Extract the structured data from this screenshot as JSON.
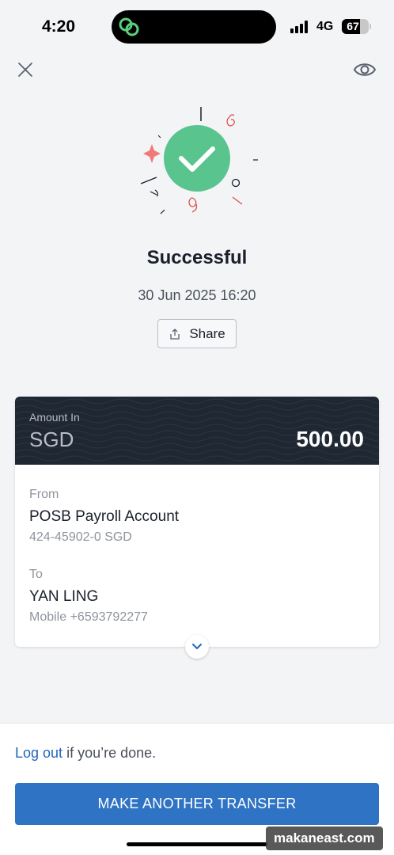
{
  "status_bar": {
    "time": "4:20",
    "network": "4G",
    "battery": "67",
    "battery_level": 0.67
  },
  "header": {
    "close_icon": "close-icon",
    "visibility_icon": "eye-icon"
  },
  "result": {
    "title": "Successful",
    "datetime": "30 Jun 2025 16:20",
    "share_label": "Share",
    "success_color": "#5ac48f"
  },
  "receipt": {
    "amount_label": "Amount In",
    "currency": "SGD",
    "amount": "500.00",
    "from": {
      "label": "From",
      "name": "POSB Payroll Account",
      "detail": "424-45902-0 SGD"
    },
    "to": {
      "label": "To",
      "name": "YAN LING",
      "detail": "Mobile +6593792277"
    }
  },
  "footer": {
    "logout_link": "Log out",
    "logout_suffix": " if you’re done.",
    "primary_button": "MAKE ANOTHER TRANSFER"
  },
  "watermark": "makaneast.com",
  "colors": {
    "accent": "#2f73c4",
    "link": "#1f66b8",
    "header_bg": "#1f2733"
  }
}
